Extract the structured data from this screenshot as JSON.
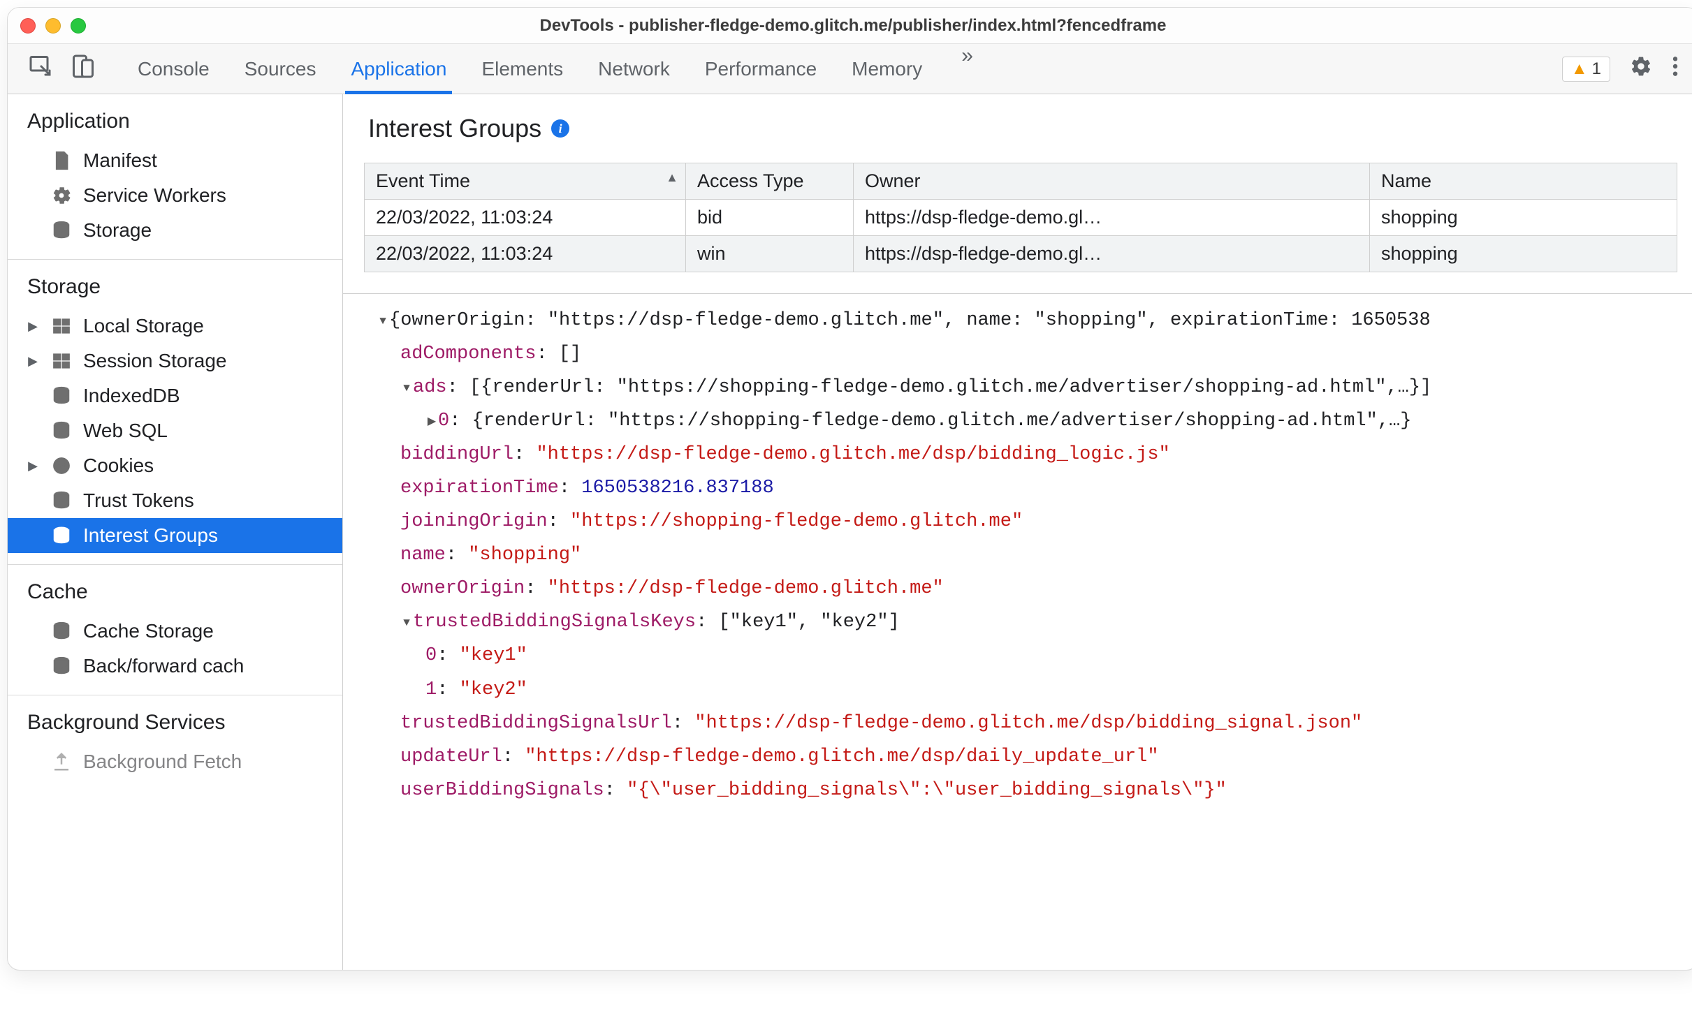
{
  "window": {
    "title": "DevTools - publisher-fledge-demo.glitch.me/publisher/index.html?fencedframe"
  },
  "tabstrip": {
    "tabs": [
      "Console",
      "Sources",
      "Application",
      "Elements",
      "Network",
      "Performance",
      "Memory"
    ],
    "active": "Application",
    "warning_count": "1"
  },
  "sidebar": {
    "sections": [
      {
        "title": "Application",
        "items": [
          {
            "label": "Manifest",
            "icon": "file"
          },
          {
            "label": "Service Workers",
            "icon": "gear"
          },
          {
            "label": "Storage",
            "icon": "database"
          }
        ]
      },
      {
        "title": "Storage",
        "items": [
          {
            "label": "Local Storage",
            "icon": "grid",
            "expandable": true
          },
          {
            "label": "Session Storage",
            "icon": "grid",
            "expandable": true
          },
          {
            "label": "IndexedDB",
            "icon": "database"
          },
          {
            "label": "Web SQL",
            "icon": "database"
          },
          {
            "label": "Cookies",
            "icon": "cookie",
            "expandable": true
          },
          {
            "label": "Trust Tokens",
            "icon": "database"
          },
          {
            "label": "Interest Groups",
            "icon": "database",
            "active": true
          }
        ]
      },
      {
        "title": "Cache",
        "items": [
          {
            "label": "Cache Storage",
            "icon": "database"
          },
          {
            "label": "Back/forward cache",
            "icon": "database",
            "truncated": true
          }
        ]
      },
      {
        "title": "Background Services",
        "items": [
          {
            "label": "Background Fetch",
            "icon": "upload",
            "truncated": true,
            "faded": true
          }
        ]
      }
    ]
  },
  "pane": {
    "title": "Interest Groups",
    "table": {
      "headers": [
        "Event Time",
        "Access Type",
        "Owner",
        "Name"
      ],
      "sorted_col": 0,
      "rows": [
        {
          "time": "22/03/2022, 11:03:24",
          "type": "bid",
          "owner": "https://dsp-fledge-demo.gl…",
          "name": "shopping"
        },
        {
          "time": "22/03/2022, 11:03:24",
          "type": "win",
          "owner": "https://dsp-fledge-demo.gl…",
          "name": "shopping"
        }
      ]
    },
    "details": {
      "root_summary": "{ownerOrigin: \"https://dsp-fledge-demo.glitch.me\", name: \"shopping\", expirationTime: 1650538",
      "adComponents": "[]",
      "ads_summary": "[{renderUrl: \"https://shopping-fledge-demo.glitch.me/advertiser/shopping-ad.html\",…}]",
      "ads_0_summary": "{renderUrl: \"https://shopping-fledge-demo.glitch.me/advertiser/shopping-ad.html\",…}",
      "biddingUrl": "\"https://dsp-fledge-demo.glitch.me/dsp/bidding_logic.js\"",
      "expirationTime": "1650538216.837188",
      "joiningOrigin": "\"https://shopping-fledge-demo.glitch.me\"",
      "name": "\"shopping\"",
      "ownerOrigin": "\"https://dsp-fledge-demo.glitch.me\"",
      "trustedBiddingSignalsKeys_summary": "[\"key1\", \"key2\"]",
      "tbsk_0": "\"key1\"",
      "tbsk_1": "\"key2\"",
      "trustedBiddingSignalsUrl": "\"https://dsp-fledge-demo.glitch.me/dsp/bidding_signal.json\"",
      "updateUrl": "\"https://dsp-fledge-demo.glitch.me/dsp/daily_update_url\"",
      "userBiddingSignals": "\"{\\\"user_bidding_signals\\\":\\\"user_bidding_signals\\\"}\""
    }
  }
}
